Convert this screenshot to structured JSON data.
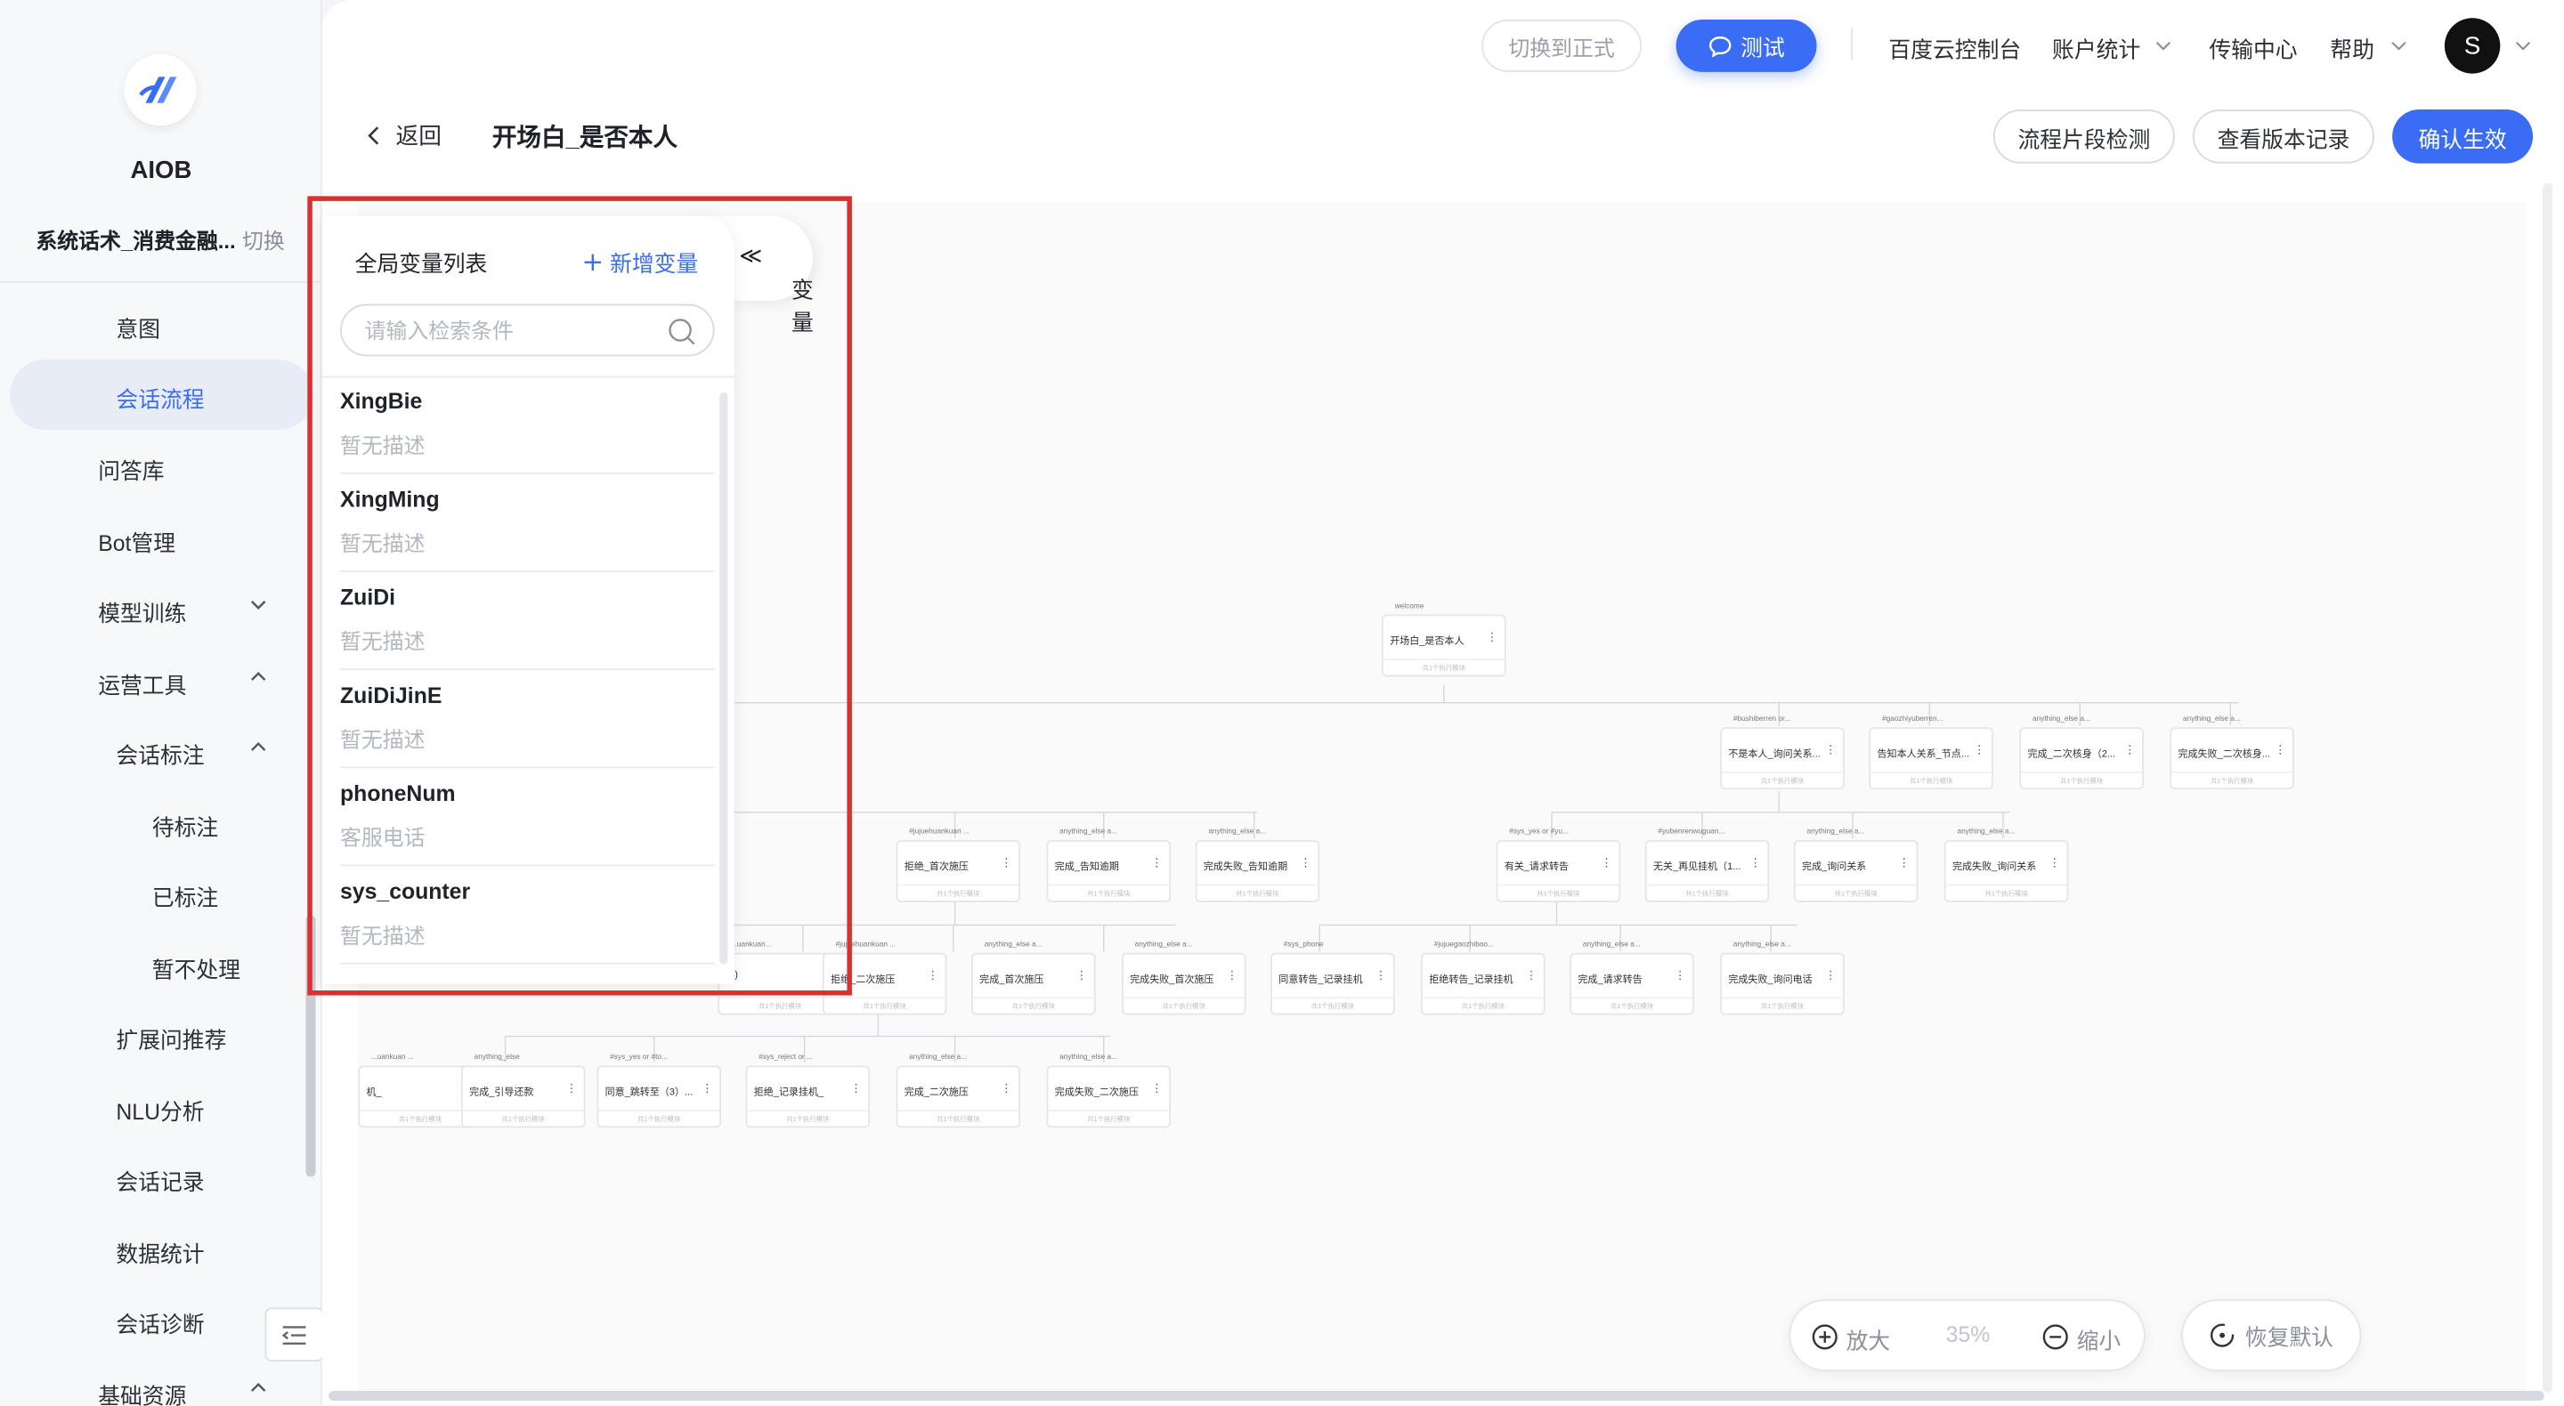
{
  "brand": {
    "name": "AIOB"
  },
  "workspace": {
    "name": "系统话术_消费金融...",
    "switch_label": "切换"
  },
  "sidebar": {
    "items": [
      {
        "label": "意图"
      },
      {
        "label": "会话流程"
      },
      {
        "label": "问答库"
      },
      {
        "label": "Bot管理"
      },
      {
        "label": "模型训练"
      },
      {
        "label": "运营工具"
      },
      {
        "label": "会话标注"
      },
      {
        "label": "待标注"
      },
      {
        "label": "已标注"
      },
      {
        "label": "暂不处理"
      },
      {
        "label": "扩展问推荐"
      },
      {
        "label": "NLU分析"
      },
      {
        "label": "会话记录"
      },
      {
        "label": "数据统计"
      },
      {
        "label": "会话诊断"
      },
      {
        "label": "基础资源"
      }
    ]
  },
  "topbar": {
    "switch_formal": "切换到正式",
    "test": "测试",
    "baidu_console": "百度云控制台",
    "account_stats": "账户统计",
    "transfer_center": "传输中心",
    "help": "帮助",
    "avatar_letter": "S"
  },
  "titlebar": {
    "back": "返回",
    "title": "开场白_是否本人",
    "check": "流程片段检测",
    "versions": "查看版本记录",
    "confirm": "确认生效"
  },
  "var_panel": {
    "title": "全局变量列表",
    "add": "新增变量",
    "tab": "变量",
    "search_placeholder": "请输入检索条件",
    "items": [
      {
        "name": "XingBie",
        "desc": "暂无描述"
      },
      {
        "name": "XingMing",
        "desc": "暂无描述"
      },
      {
        "name": "ZuiDi",
        "desc": "暂无描述"
      },
      {
        "name": "ZuiDiJinE",
        "desc": "暂无描述"
      },
      {
        "name": "phoneNum",
        "desc": "客服电话"
      },
      {
        "name": "sys_counter",
        "desc": "暂无描述"
      }
    ]
  },
  "flow": {
    "nodes": [
      {
        "label": "welcome",
        "title": "开场白_是否本人"
      },
      {
        "label": "#bushiberren or...",
        "title": "不是本人_询问关系..."
      },
      {
        "label": "#gaozhiyuberren...",
        "title": "告知本人关系_节点..."
      },
      {
        "label": "anything_else a...",
        "title": "完成_二次核身（2..."
      },
      {
        "label": "anything_else a...",
        "title": "完成失败_二次核身..."
      },
      {
        "label": "#jujuehuankuan ...",
        "title": "拒绝_首次施压"
      },
      {
        "label": "anything_else a...",
        "title": "完成_告知逾期"
      },
      {
        "label": "anything_else a...",
        "title": "完成失败_告知逾期"
      },
      {
        "label": "#sys_yes or #yu...",
        "title": "有关_请求转告"
      },
      {
        "label": "#yubenrenwuguan...",
        "title": "无关_再见挂机（1..."
      },
      {
        "label": "anything_else a...",
        "title": "完成_询问关系"
      },
      {
        "label": "anything_else a...",
        "title": "完成失败_询问关系"
      },
      {
        "label": "...uankuan...",
        "title": "(3)"
      },
      {
        "label": "#jujuehuankuan ...",
        "title": "拒绝_二次施压"
      },
      {
        "label": "anything_else a...",
        "title": "完成_首次施压"
      },
      {
        "label": "anything_else a...",
        "title": "完成失败_首次施压"
      },
      {
        "label": "#sys_phone",
        "title": "同意转告_记录挂机"
      },
      {
        "label": "#jujuegaozhibao...",
        "title": "拒绝转告_记录挂机"
      },
      {
        "label": "anything_else a...",
        "title": "完成_请求转告"
      },
      {
        "label": "anything_else a...",
        "title": "完成失败_询问电话"
      },
      {
        "label": "...uankuan ...",
        "title": "机_"
      },
      {
        "label": "anything_else",
        "title": "完成_引导还款"
      },
      {
        "label": "#sys_yes or #to...",
        "title": "同意_跳转至（3）..."
      },
      {
        "label": "#sys_reject or ...",
        "title": "拒绝_记录挂机_"
      },
      {
        "label": "anything_else a...",
        "title": "完成_二次施压"
      },
      {
        "label": "anything_else a...",
        "title": "完成失败_二次施压"
      }
    ],
    "node_footer": "共1个执行模块"
  },
  "zoom": {
    "zoom_in": "放大",
    "level": "35%",
    "zoom_out": "缩小",
    "reset": "恢复默认"
  },
  "colors": {
    "accent": "#3a6cf4",
    "highlight": "#dc2f2f"
  }
}
